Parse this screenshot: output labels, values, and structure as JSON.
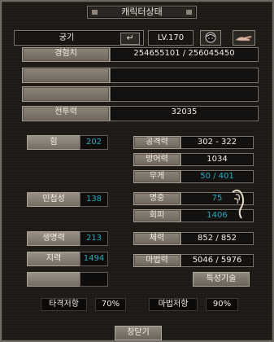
{
  "window": {
    "title": "캐릭터상태"
  },
  "header": {
    "name": "궁기",
    "level": "LV.170",
    "enter_icon": "↵"
  },
  "bars": {
    "exp_label": "경험치",
    "exp_value": "254655101 / 256045450",
    "power_label": "전투력",
    "power_value": "32035"
  },
  "stats": {
    "str": {
      "label": "힘",
      "value": "202"
    },
    "agi": {
      "label": "민첩성",
      "value": "138"
    },
    "con": {
      "label": "생명력",
      "value": "213"
    },
    "int": {
      "label": "지력",
      "value": "1494"
    }
  },
  "right_stats": {
    "attack": {
      "label": "공격력",
      "value": "302 - 322"
    },
    "defense": {
      "label": "방어력",
      "value": "1034"
    },
    "weight": {
      "label": "무게",
      "value": "50 / 401"
    },
    "accuracy": {
      "label": "명중",
      "value": "75"
    },
    "evasion": {
      "label": "회피",
      "value": "1406"
    },
    "hp": {
      "label": "체력",
      "value": "852 / 852"
    },
    "mp": {
      "label": "마법력",
      "value": "5046 / 5976"
    }
  },
  "buttons": {
    "skills": "특성기술",
    "close": "창닫기"
  },
  "resist": {
    "strike_label": "타격저항",
    "strike_value": "70%",
    "magic_label": "마법저항",
    "magic_value": "90%"
  },
  "colors": {
    "stat_value": "#28a8bf",
    "text": "#f2ede3"
  },
  "icons": {
    "face": "face-icon",
    "hand": "hand-icon",
    "claw": "claw-icon"
  }
}
